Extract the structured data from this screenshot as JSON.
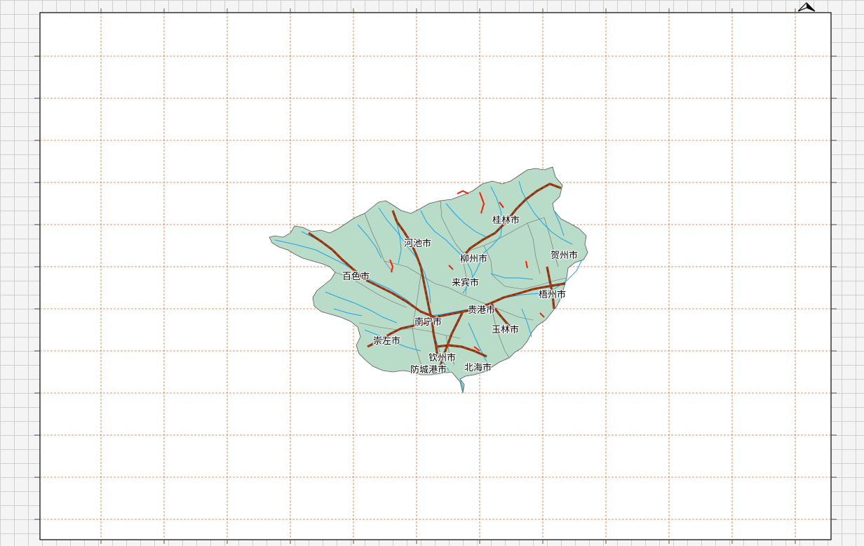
{
  "map": {
    "frame_color": "#000000",
    "grid_line_color": "#e07030",
    "region_fill": "#b9dcc8",
    "region_stroke": "#555555",
    "river_color": "#1aa5e6",
    "railway_color": "#7a3a1a",
    "railway_dash_color": "#ff2a00",
    "north_arrow_icon": "north-arrow-icon"
  },
  "cities": [
    {
      "name": "桂林市"
    },
    {
      "name": "河池市"
    },
    {
      "name": "柳州市"
    },
    {
      "name": "贺州市"
    },
    {
      "name": "百色市"
    },
    {
      "name": "来宾市"
    },
    {
      "name": "梧州市"
    },
    {
      "name": "贵港市"
    },
    {
      "name": "南宁市"
    },
    {
      "name": "玉林市"
    },
    {
      "name": "崇左市"
    },
    {
      "name": "钦州市"
    },
    {
      "name": "防城港市"
    },
    {
      "name": "北海市"
    }
  ]
}
